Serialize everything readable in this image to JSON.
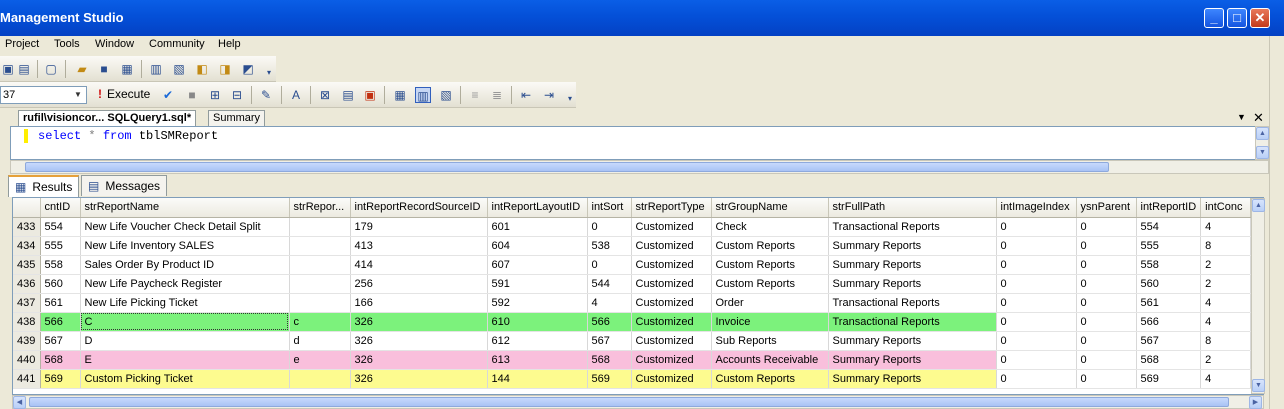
{
  "window": {
    "title": "Management Studio",
    "buttons": [
      "_",
      "□",
      "✕"
    ]
  },
  "menu": [
    "Project",
    "Tools",
    "Window",
    "Community",
    "Help"
  ],
  "toolbar2": {
    "db_combo": "37",
    "execute_label": "Execute"
  },
  "doc_tabs": {
    "active": "rufil\\visioncor... SQLQuery1.sql*",
    "second": "Summary"
  },
  "editor": {
    "kw1": "select",
    "star": "*",
    "kw2": "from",
    "table": "tblSMReport"
  },
  "result_tabs": {
    "results": "Results",
    "messages": "Messages"
  },
  "grid": {
    "columns": [
      "",
      "cntID",
      "strReportName",
      "strRepor...",
      "intReportRecordSourceID",
      "intReportLayoutID",
      "intSort",
      "strReportType",
      "strGroupName",
      "strFullPath",
      "intImageIndex",
      "ysnParent",
      "intReportID",
      "intConc"
    ],
    "rows": [
      {
        "c": [
          "433",
          "554",
          "New Life Voucher Check Detail Split",
          "",
          "179",
          "601",
          "0",
          "Customized",
          "Check",
          "Transactional Reports",
          "0",
          "0",
          "554",
          "4"
        ]
      },
      {
        "c": [
          "434",
          "555",
          "New Life Inventory SALES",
          "",
          "413",
          "604",
          "538",
          "Customized",
          "Custom Reports",
          "Summary Reports",
          "0",
          "0",
          "555",
          "8"
        ]
      },
      {
        "c": [
          "435",
          "558",
          "Sales Order By Product ID",
          "",
          "414",
          "607",
          "0",
          "Customized",
          "Custom Reports",
          "Summary Reports",
          "0",
          "0",
          "558",
          "2"
        ]
      },
      {
        "c": [
          "436",
          "560",
          "New Life Paycheck Register",
          "",
          "256",
          "591",
          "544",
          "Customized",
          "Custom Reports",
          "Summary Reports",
          "0",
          "0",
          "560",
          "2"
        ]
      },
      {
        "c": [
          "437",
          "561",
          "New Life Picking Ticket",
          "",
          "166",
          "592",
          "4",
          "Customized",
          "Order",
          "Transactional Reports",
          "0",
          "0",
          "561",
          "4"
        ]
      },
      {
        "c": [
          "438",
          "566",
          "C",
          "c",
          "326",
          "610",
          "566",
          "Customized",
          "Invoice",
          "Transactional Reports",
          "0",
          "0",
          "566",
          "4"
        ],
        "hl": "green"
      },
      {
        "c": [
          "439",
          "567",
          "D",
          "d",
          "326",
          "612",
          "567",
          "Customized",
          "Sub Reports",
          "Summary Reports",
          "0",
          "0",
          "567",
          "8"
        ]
      },
      {
        "c": [
          "440",
          "568",
          "E",
          "e",
          "326",
          "613",
          "568",
          "Customized",
          "Accounts Receivable",
          "Summary Reports",
          "0",
          "0",
          "568",
          "2"
        ],
        "hl": "pink"
      },
      {
        "c": [
          "441",
          "569",
          "Custom Picking Ticket",
          "",
          "326",
          "144",
          "569",
          "Customized",
          "Custom Reports",
          "Summary Reports",
          "0",
          "0",
          "569",
          "4"
        ],
        "hl": "yellow"
      }
    ]
  },
  "colors": {
    "title_bar": "#0450d8",
    "green_highlight": "#7cf27c",
    "pink_highlight": "#f9bfdc",
    "yellow_highlight": "#fdfb8f",
    "keyword": "#0000ff"
  }
}
